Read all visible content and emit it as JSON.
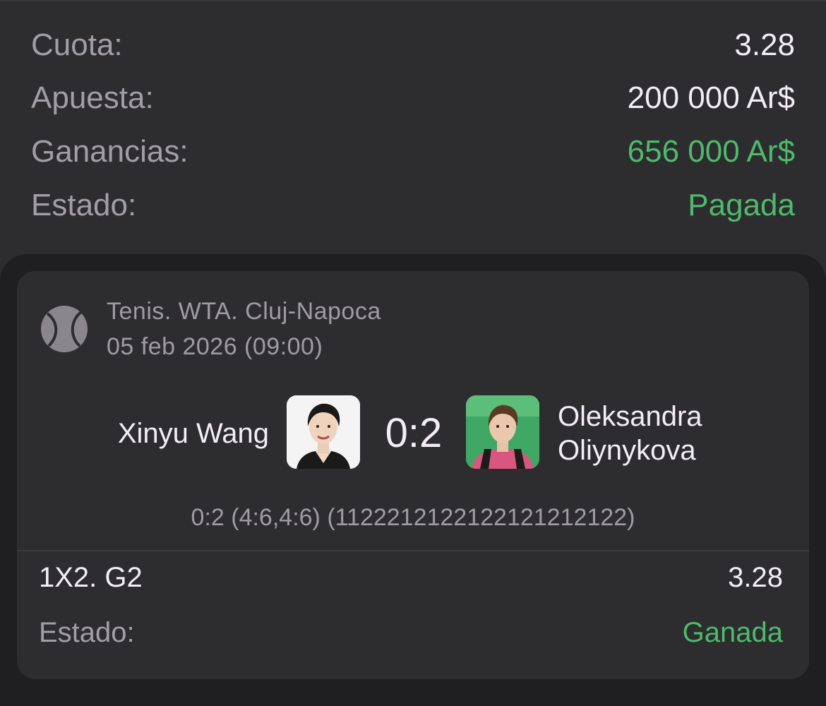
{
  "summary": {
    "odds_label": "Cuota:",
    "odds_value": "3.28",
    "stake_label": "Apuesta:",
    "stake_value": "200 000 Ar$",
    "winnings_label": "Ganancias:",
    "winnings_value": "656 000 Ar$",
    "status_label": "Estado:",
    "status_value": "Pagada"
  },
  "event": {
    "sport_icon": "tennis-ball-icon",
    "league": "Tenis. WTA. Cluj-Napoca",
    "date": "05 feb 2026 (09:00)",
    "player1": "Xinyu Wang",
    "score": "0:2",
    "player2_line1": "Oleksandra",
    "player2_line2": "Oliynykova",
    "set_detail": "0:2 (4:6,4:6) (1122212122122121212122)"
  },
  "market": {
    "name": "1X2. G2",
    "odds": "3.28",
    "status_label": "Estado:",
    "status_value": "Ganada"
  },
  "colors": {
    "background": "#232325",
    "panel": "#2d2d30",
    "text": "#f3eef5",
    "muted": "#a39ea6",
    "green": "#4dbb6a"
  }
}
